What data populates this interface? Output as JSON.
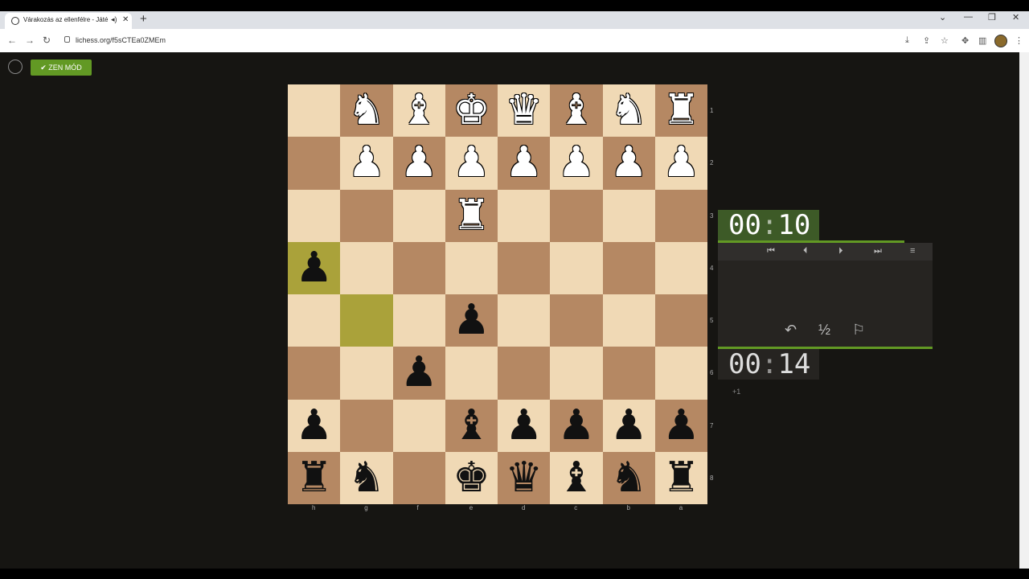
{
  "browser": {
    "tab_title": "Várakozás az ellenfélre - Játé",
    "tab_audio_icon": "speaker-icon",
    "tab_close": "✕",
    "new_tab": "+",
    "url": "lichess.org/f5sCTEa0ZMEm",
    "window_controls": [
      "⌄",
      "—",
      "❐",
      "✕"
    ]
  },
  "header": {
    "zen_label": "ZEN MÓD",
    "zen_icon": "check-icon"
  },
  "board": {
    "orientation": "black",
    "ranks": [
      "1",
      "2",
      "3",
      "4",
      "5",
      "6",
      "7",
      "8"
    ],
    "files": [
      "h",
      "g",
      "f",
      "e",
      "d",
      "c",
      "b",
      "a"
    ],
    "highlight_squares": [
      "h4",
      "g5"
    ],
    "rows": [
      [
        "",
        "N",
        "B",
        "K",
        "Q",
        "B",
        "N",
        "R"
      ],
      [
        "",
        "P",
        "P",
        "P",
        "P",
        "P",
        "P",
        "P"
      ],
      [
        "",
        "",
        "",
        "R",
        "",
        "",
        "",
        ""
      ],
      [
        "p",
        "",
        "",
        "",
        "",
        "",
        "",
        ""
      ],
      [
        "",
        "",
        "",
        "p",
        "",
        "",
        "",
        ""
      ],
      [
        "",
        "",
        "p",
        "",
        "",
        "",
        "",
        ""
      ],
      [
        "p",
        "",
        "",
        "b",
        "p",
        "p",
        "p",
        "p"
      ],
      [
        "r",
        "n",
        "",
        "k",
        "q",
        "b",
        "n",
        "r"
      ]
    ]
  },
  "clocks": {
    "opponent": {
      "min": "00",
      "sec": "10",
      "progress": 0.87
    },
    "player": {
      "min": "00",
      "sec": "14",
      "progress": 1.0
    },
    "increment": "+1"
  },
  "controls": {
    "nav": [
      "first-icon",
      "prev-icon",
      "next-icon",
      "last-icon",
      "menu-icon"
    ],
    "actions": {
      "takeback_icon": "undo-icon",
      "draw_label": "½",
      "resign_icon": "flag-icon"
    }
  },
  "colors": {
    "light": "#f0d9b5",
    "dark": "#b58863",
    "accent": "#629924"
  }
}
